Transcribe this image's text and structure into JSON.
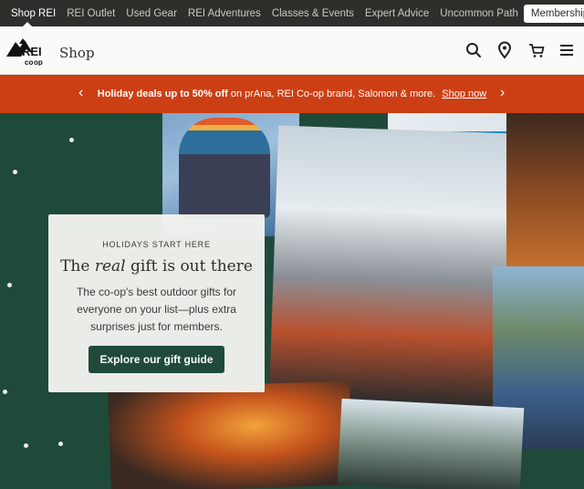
{
  "topnav": {
    "items": [
      "Shop REI",
      "REI Outlet",
      "Used Gear",
      "REI Adventures",
      "Classes & Events",
      "Expert Advice",
      "Uncommon Path"
    ],
    "membership": "Membership"
  },
  "header": {
    "logo_text": "REI co-op",
    "shop_label": "Shop"
  },
  "promo": {
    "bold_text": "Holiday deals up to 50% off",
    "text": " on prAna, REI Co-op brand, Salomon & more.",
    "link": "Shop now"
  },
  "hero": {
    "eyebrow": "HOLIDAYS START HERE",
    "headline_before": "The ",
    "headline_em": "real",
    "headline_after": " gift is out there",
    "body": "The co-op's best outdoor gifts for everyone on your list—plus extra surprises just for members.",
    "cta": "Explore our gift guide"
  },
  "colors": {
    "promo_bg": "#cc3f14",
    "brand_green": "#1f4a3a",
    "topnav_bg": "#2e2e2b"
  }
}
